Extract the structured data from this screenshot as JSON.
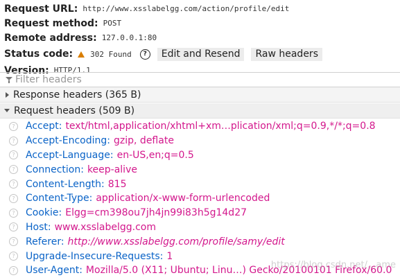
{
  "summary": {
    "url_label": "Request URL:",
    "url_value": "http://www.xsslabelgg.com/action/profile/edit",
    "method_label": "Request method:",
    "method_value": "POST",
    "remote_label": "Remote address:",
    "remote_value": "127.0.0.1:80",
    "status_label": "Status code:",
    "status_value": "302 Found",
    "status_icon": "warning-triangle-icon",
    "status_color": "#d97e00",
    "help_icon": "?",
    "edit_resend_label": "Edit and Resend",
    "raw_headers_label": "Raw headers",
    "version_label": "Version:",
    "version_value": "HTTP/1.1"
  },
  "filter": {
    "placeholder": "Filter headers"
  },
  "sections": {
    "response_headers_label": "Response headers (365 B)",
    "request_headers_label": "Request headers (509 B)"
  },
  "request_headers": [
    {
      "name": "Accept:",
      "value": "text/html,application/xhtml+xm…plication/xml;q=0.9,*/*;q=0.8",
      "italic": false
    },
    {
      "name": "Accept-Encoding:",
      "value": "gzip, deflate",
      "italic": false
    },
    {
      "name": "Accept-Language:",
      "value": "en-US,en;q=0.5",
      "italic": false
    },
    {
      "name": "Connection:",
      "value": "keep-alive",
      "italic": false
    },
    {
      "name": "Content-Length:",
      "value": "815",
      "italic": false
    },
    {
      "name": "Content-Type:",
      "value": "application/x-www-form-urlencoded",
      "italic": false
    },
    {
      "name": "Cookie:",
      "value": "Elgg=cm398ou7jh4jn99i83h5g14d27",
      "italic": false
    },
    {
      "name": "Host:",
      "value": "www.xsslabelgg.com",
      "italic": false
    },
    {
      "name": "Referer:",
      "value": "http://www.xsslabelgg.com/profile/samy/edit",
      "italic": true
    },
    {
      "name": "Upgrade-Insecure-Requests:",
      "value": "1",
      "italic": false
    },
    {
      "name": "User-Agent:",
      "value": "Mozilla/5.0 (X11; Ubuntu; Linu…) Gecko/20100101 Firefox/60.0",
      "italic": false
    }
  ],
  "row_icon": "?",
  "watermark": "https://blog.csdn.net/...ame",
  "colors": {
    "header_name": "#0a63c7",
    "header_value": "#d3178c",
    "warning": "#d97e00"
  }
}
